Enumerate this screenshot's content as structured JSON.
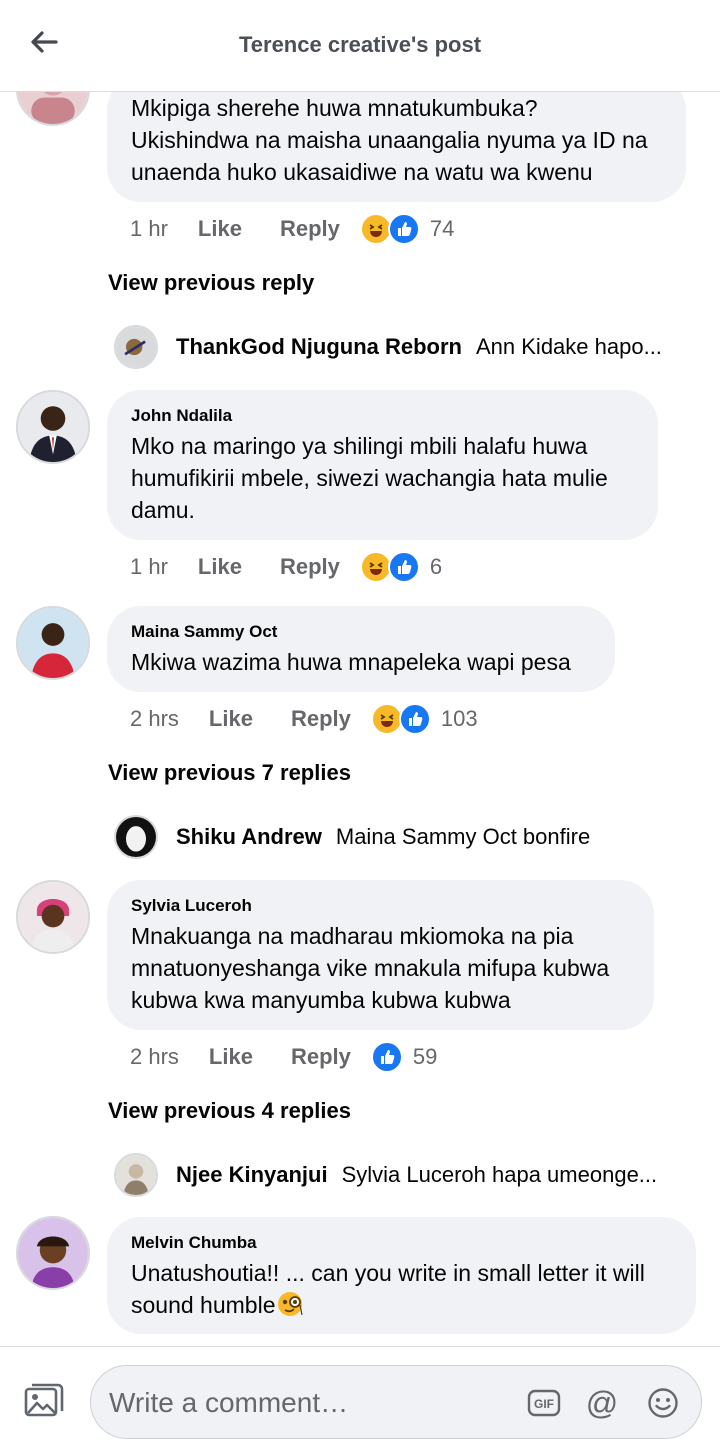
{
  "header": {
    "title": "Terence creative's post"
  },
  "comments": [
    {
      "name": "",
      "text": "Mkipiga sherehe huwa mnatukumbuka?\nUkishindwa na maisha unaangalia nyuma ya ID na unaenda huko ukasaidiwe na watu wa kwenu",
      "time": "1 hr",
      "like": "Like",
      "reply": "Reply",
      "reactions": [
        "haha",
        "like"
      ],
      "count": "74"
    },
    {
      "name": "John Ndalila",
      "text": "Mko na maringo ya shilingi mbili halafu huwa humufikirii mbele, siwezi wachangia hata mulie damu.",
      "time": "1 hr",
      "like": "Like",
      "reply": "Reply",
      "reactions": [
        "haha",
        "like"
      ],
      "count": "6"
    },
    {
      "name": "Maina Sammy Oct",
      "text": "Mkiwa wazima huwa mnapeleka wapi pesa",
      "time": "2 hrs",
      "like": "Like",
      "reply": "Reply",
      "reactions": [
        "haha",
        "like"
      ],
      "count": "103"
    },
    {
      "name": "Sylvia Luceroh",
      "text": "Mnakuanga na madharau mkiomoka  na pia mnatuonyeshanga vike mnakula mifupa kubwa kubwa  kwa manyumba kubwa kubwa",
      "time": "2 hrs",
      "like": "Like",
      "reply": "Reply",
      "reactions": [
        "like"
      ],
      "count": "59"
    },
    {
      "name": "Melvin Chumba",
      "text": "Unatushoutia!! ... can you write in small letter it will sound humble"
    }
  ],
  "view_previous": [
    "View previous reply",
    "View previous 7 replies",
    "View previous 4 replies"
  ],
  "replies": [
    {
      "name": "ThankGod Njuguna Reborn",
      "text": "Ann Kidake hapo..."
    },
    {
      "name": "Shiku Andrew",
      "text": "Maina Sammy Oct bonfire"
    },
    {
      "name": "Njee Kinyanjui",
      "text": "Sylvia Luceroh hapa umeonge..."
    }
  ],
  "composer": {
    "placeholder": "Write a comment…",
    "gif_label": "GIF",
    "at_label": "@"
  },
  "colors": {
    "like_blue": "#1877f2",
    "haha_yellow": "#f7b928",
    "bubble_bg": "#f0f2f5",
    "meta_gray": "#65676b"
  },
  "icons": [
    "back-arrow-icon",
    "haha-emoji-icon",
    "like-thumb-icon",
    "monocle-emoji-icon",
    "photo-icon",
    "gif-icon",
    "at-icon",
    "smiley-icon"
  ]
}
